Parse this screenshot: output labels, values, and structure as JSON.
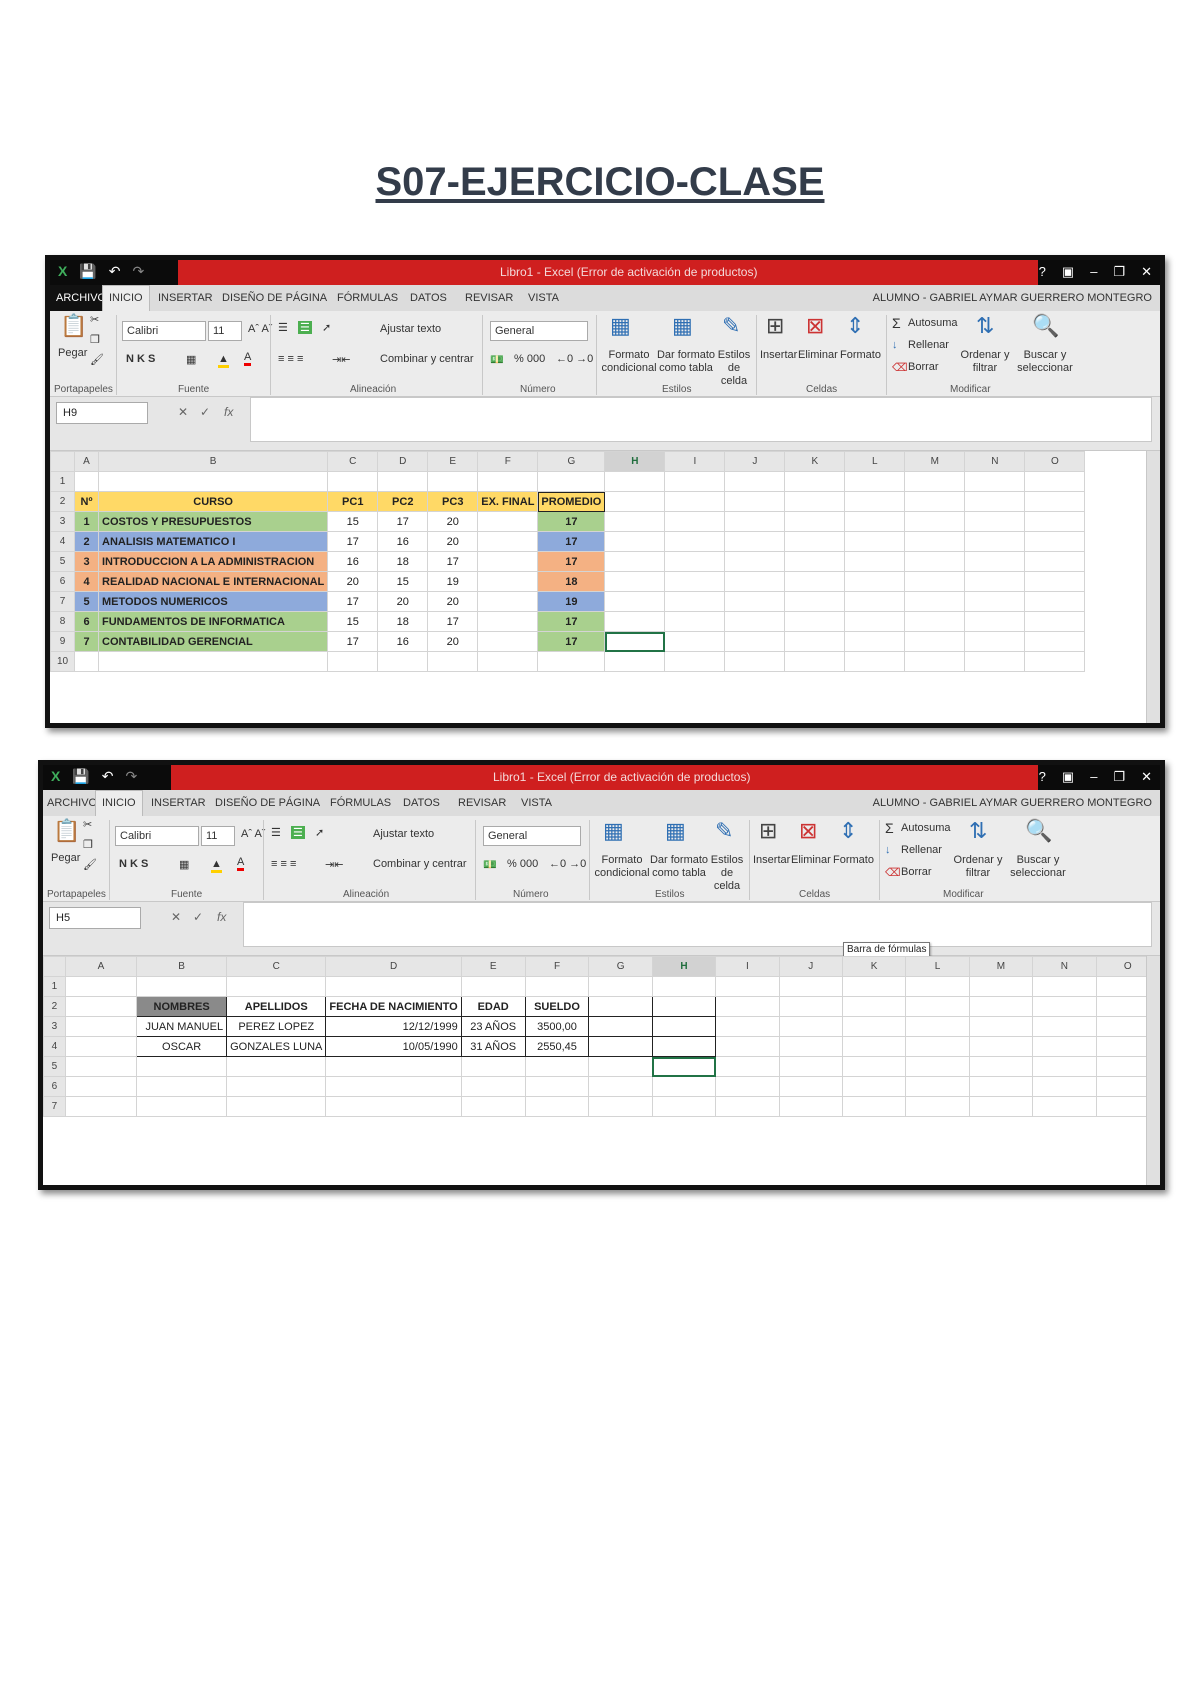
{
  "page_title": "S07-EJERCICIO-CLASE",
  "shot1": {
    "window_title": "Libro1 - Excel (Error de activación de productos)",
    "tabs": [
      "ARCHIVO",
      "INICIO",
      "INSERTAR",
      "DISEÑO DE PÁGINA",
      "FÓRMULAS",
      "DATOS",
      "REVISAR",
      "VISTA"
    ],
    "user": "ALUMNO - GABRIEL AYMAR GUERRERO MONTEGRO",
    "ribbon": {
      "paste": "Pegar",
      "font_name": "Calibri",
      "font_size": "11",
      "bold_italic_underline": "N K S",
      "wrap_text": "Ajustar texto",
      "merge_center": "Combinar y centrar",
      "number_format": "General",
      "number_buttons": "% 000",
      "cond_format": "Formato condicional",
      "format_table": "Dar formato como tabla",
      "cell_styles": "Estilos de celda",
      "insert": "Insertar",
      "delete": "Eliminar",
      "format": "Formato",
      "autosum": "Autosuma",
      "fill": "Rellenar",
      "clear": "Borrar",
      "sort_filter": "Ordenar y filtrar",
      "find_select": "Buscar y seleccionar",
      "groups": [
        "Portapapeles",
        "Fuente",
        "Alineación",
        "Número",
        "Estilos",
        "Celdas",
        "Modificar"
      ]
    },
    "name_box": "H9",
    "fx": "fx",
    "columns": [
      "A",
      "B",
      "C",
      "D",
      "E",
      "F",
      "G",
      "H",
      "I",
      "J",
      "K",
      "L",
      "M",
      "N",
      "O"
    ],
    "headers": [
      "Nº",
      "CURSO",
      "PC1",
      "PC2",
      "PC3",
      "EX. FINAL",
      "PROMEDIO"
    ],
    "rows": [
      {
        "n": "1",
        "curso": "COSTOS Y PRESUPUESTOS",
        "pc1": "15",
        "pc2": "17",
        "pc3": "20",
        "ex": "",
        "prom": "17"
      },
      {
        "n": "2",
        "curso": "ANALISIS MATEMATICO I",
        "pc1": "17",
        "pc2": "16",
        "pc3": "20",
        "ex": "",
        "prom": "17"
      },
      {
        "n": "3",
        "curso": "INTRODUCCION A LA ADMINISTRACION",
        "pc1": "16",
        "pc2": "18",
        "pc3": "17",
        "ex": "",
        "prom": "17"
      },
      {
        "n": "4",
        "curso": "REALIDAD NACIONAL E INTERNACIONAL",
        "pc1": "20",
        "pc2": "15",
        "pc3": "19",
        "ex": "",
        "prom": "18"
      },
      {
        "n": "5",
        "curso": "METODOS NUMERICOS",
        "pc1": "17",
        "pc2": "20",
        "pc3": "20",
        "ex": "",
        "prom": "19"
      },
      {
        "n": "6",
        "curso": "FUNDAMENTOS DE INFORMATICA",
        "pc1": "15",
        "pc2": "18",
        "pc3": "17",
        "ex": "",
        "prom": "17"
      },
      {
        "n": "7",
        "curso": "CONTABILIDAD GERENCIAL",
        "pc1": "17",
        "pc2": "16",
        "pc3": "20",
        "ex": "",
        "prom": "17"
      }
    ],
    "colors": {
      "green": "#a9d08e",
      "blue": "#8eaadb",
      "orange": "#f4b183",
      "yellow": "#ffd966"
    }
  },
  "shot2": {
    "window_title": "Libro1 - Excel (Error de activación de productos)",
    "tabs": [
      "ARCHIVO",
      "INICIO",
      "INSERTAR",
      "DISEÑO DE PÁGINA",
      "FÓRMULAS",
      "DATOS",
      "REVISAR",
      "VISTA"
    ],
    "user": "ALUMNO - GABRIEL AYMAR GUERRERO MONTEGRO",
    "name_box": "H5",
    "fx": "fx",
    "tooltip": "Barra de fórmulas",
    "columns": [
      "A",
      "B",
      "C",
      "D",
      "E",
      "F",
      "G",
      "H",
      "I",
      "J",
      "K",
      "L",
      "M",
      "N",
      "O"
    ],
    "headers": [
      "NOMBRES",
      "APELLIDOS",
      "FECHA DE NACIMIENTO",
      "EDAD",
      "SUELDO"
    ],
    "rows": [
      {
        "nombre": "JUAN MANUEL",
        "apellido": "PEREZ LOPEZ",
        "fecha": "12/12/1999",
        "edad": "23 AÑOS",
        "sueldo": "3500,00"
      },
      {
        "nombre": "OSCAR",
        "apellido": "GONZALES LUNA",
        "fecha": "10/05/1990",
        "edad": "31 AÑOS",
        "sueldo": "2550,45"
      }
    ]
  }
}
